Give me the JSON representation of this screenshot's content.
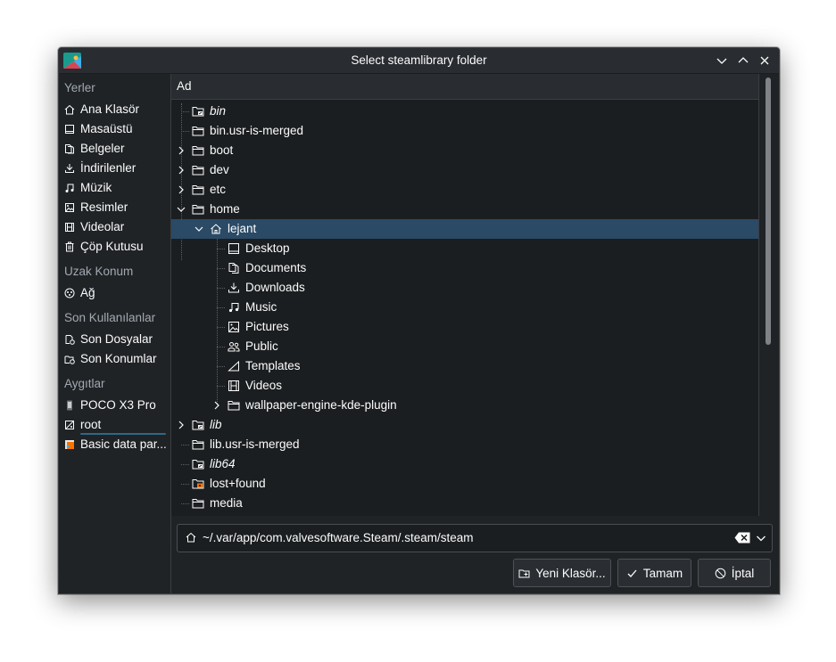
{
  "window": {
    "title": "Select steamlibrary folder"
  },
  "sidebar": {
    "sections": [
      {
        "title": "Yerler",
        "items": [
          {
            "label": "Ana Klasör",
            "icon": "home-icon"
          },
          {
            "label": "Masaüstü",
            "icon": "desktop-icon"
          },
          {
            "label": "Belgeler",
            "icon": "documents-icon"
          },
          {
            "label": "İndirilenler",
            "icon": "download-icon"
          },
          {
            "label": "Müzik",
            "icon": "music-icon"
          },
          {
            "label": "Resimler",
            "icon": "pictures-icon"
          },
          {
            "label": "Videolar",
            "icon": "video-icon"
          },
          {
            "label": "Çöp Kutusu",
            "icon": "trash-icon"
          }
        ]
      },
      {
        "title": "Uzak Konum",
        "items": [
          {
            "label": "Ağ",
            "icon": "network-icon"
          }
        ]
      },
      {
        "title": "Son Kullanılanlar",
        "items": [
          {
            "label": "Son Dosyalar",
            "icon": "recent-files-icon"
          },
          {
            "label": "Son Konumlar",
            "icon": "recent-locations-icon"
          }
        ]
      },
      {
        "title": "Aygıtlar",
        "items": [
          {
            "label": "POCO X3 Pro",
            "icon": "phone-icon"
          },
          {
            "label": "root",
            "icon": "drive-icon"
          },
          {
            "label": "Basic data par...",
            "icon": "partition-icon"
          }
        ]
      }
    ]
  },
  "tree": {
    "column_header": "Ad",
    "rows": [
      {
        "label": "bin",
        "italic": true,
        "expander": "none",
        "icon": "folder-link-icon"
      },
      {
        "label": "bin.usr-is-merged",
        "italic": false,
        "expander": "none",
        "icon": "folder-icon"
      },
      {
        "label": "boot",
        "italic": false,
        "expander": "collapsed",
        "icon": "folder-icon"
      },
      {
        "label": "dev",
        "italic": false,
        "expander": "collapsed",
        "icon": "folder-icon"
      },
      {
        "label": "etc",
        "italic": false,
        "expander": "collapsed",
        "icon": "folder-icon"
      },
      {
        "label": "home",
        "italic": false,
        "expander": "expanded",
        "icon": "folder-icon"
      },
      {
        "label": "lejant",
        "italic": false,
        "expander": "expanded",
        "icon": "home-icon",
        "selected": true
      },
      {
        "label": "Desktop",
        "italic": false,
        "expander": "none",
        "icon": "desktop-icon"
      },
      {
        "label": "Documents",
        "italic": false,
        "expander": "none",
        "icon": "documents-icon"
      },
      {
        "label": "Downloads",
        "italic": false,
        "expander": "none",
        "icon": "download-icon"
      },
      {
        "label": "Music",
        "italic": false,
        "expander": "none",
        "icon": "music-icon"
      },
      {
        "label": "Pictures",
        "italic": false,
        "expander": "none",
        "icon": "pictures-icon"
      },
      {
        "label": "Public",
        "italic": false,
        "expander": "none",
        "icon": "public-icon"
      },
      {
        "label": "Templates",
        "italic": false,
        "expander": "none",
        "icon": "templates-icon"
      },
      {
        "label": "Videos",
        "italic": false,
        "expander": "none",
        "icon": "video-icon"
      },
      {
        "label": "wallpaper-engine-kde-plugin",
        "italic": false,
        "expander": "collapsed",
        "icon": "folder-icon"
      },
      {
        "label": "lib",
        "italic": true,
        "expander": "collapsed",
        "icon": "folder-link-icon"
      },
      {
        "label": "lib.usr-is-merged",
        "italic": false,
        "expander": "none",
        "icon": "folder-icon"
      },
      {
        "label": "lib64",
        "italic": true,
        "expander": "none",
        "icon": "folder-link-icon"
      },
      {
        "label": "lost+found",
        "italic": false,
        "expander": "none",
        "icon": "folder-locked-icon"
      },
      {
        "label": "media",
        "italic": false,
        "expander": "none",
        "icon": "folder-icon"
      }
    ]
  },
  "location": {
    "path": "~/.var/app/com.valvesoftware.Steam/.steam/steam"
  },
  "buttons": {
    "new_folder": "Yeni Klasör...",
    "ok": "Tamam",
    "cancel": "İptal"
  },
  "colors": {
    "window_bg": "#202326",
    "view_bg": "#1b1e20",
    "selection": "#2a4a66",
    "accent": "#3daee9",
    "text": "#fcfcfc",
    "dim_text": "#a1a9b1"
  }
}
